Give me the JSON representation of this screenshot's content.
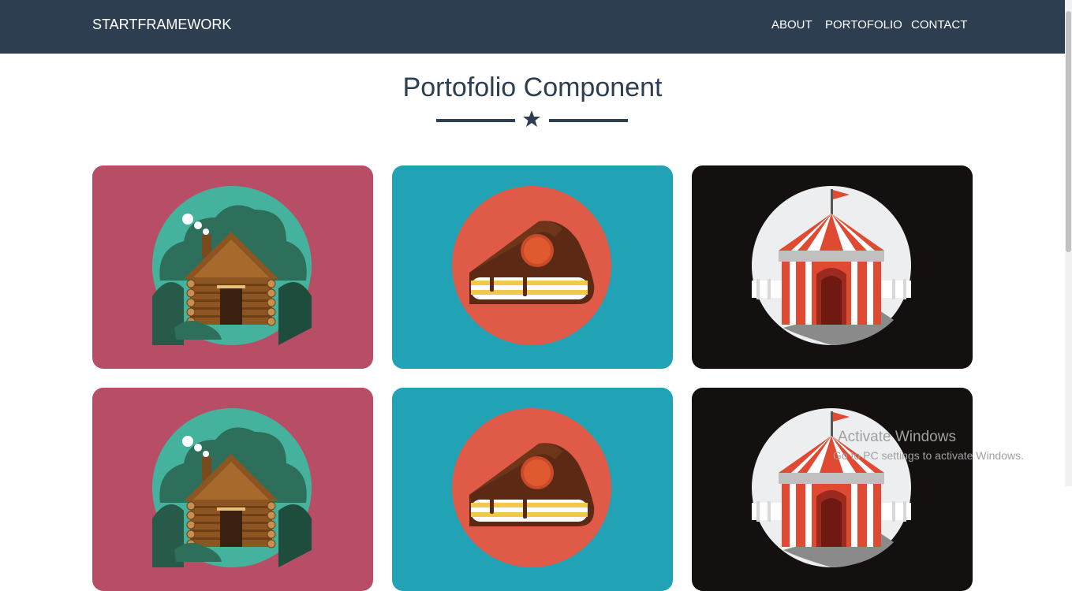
{
  "navbar": {
    "brand": "STARTFRAMEWORK",
    "links": [
      "ABOUT",
      "PORTOFOLIO",
      "CONTACT"
    ],
    "background": "#2c3e50"
  },
  "section": {
    "title": "Portofolio Component",
    "divider_icon": "star-icon"
  },
  "portfolio": {
    "items": [
      {
        "image": "log-cabin",
        "background": "#b84d66"
      },
      {
        "image": "cake-slice",
        "background": "#22a2b5"
      },
      {
        "image": "circus-tent",
        "background": "#141010"
      },
      {
        "image": "log-cabin",
        "background": "#b84d66"
      },
      {
        "image": "cake-slice",
        "background": "#22a2b5"
      },
      {
        "image": "circus-tent",
        "background": "#141010"
      }
    ]
  },
  "watermark": {
    "title": "Activate Windows",
    "subtitle": "Go to PC settings to activate Windows."
  }
}
